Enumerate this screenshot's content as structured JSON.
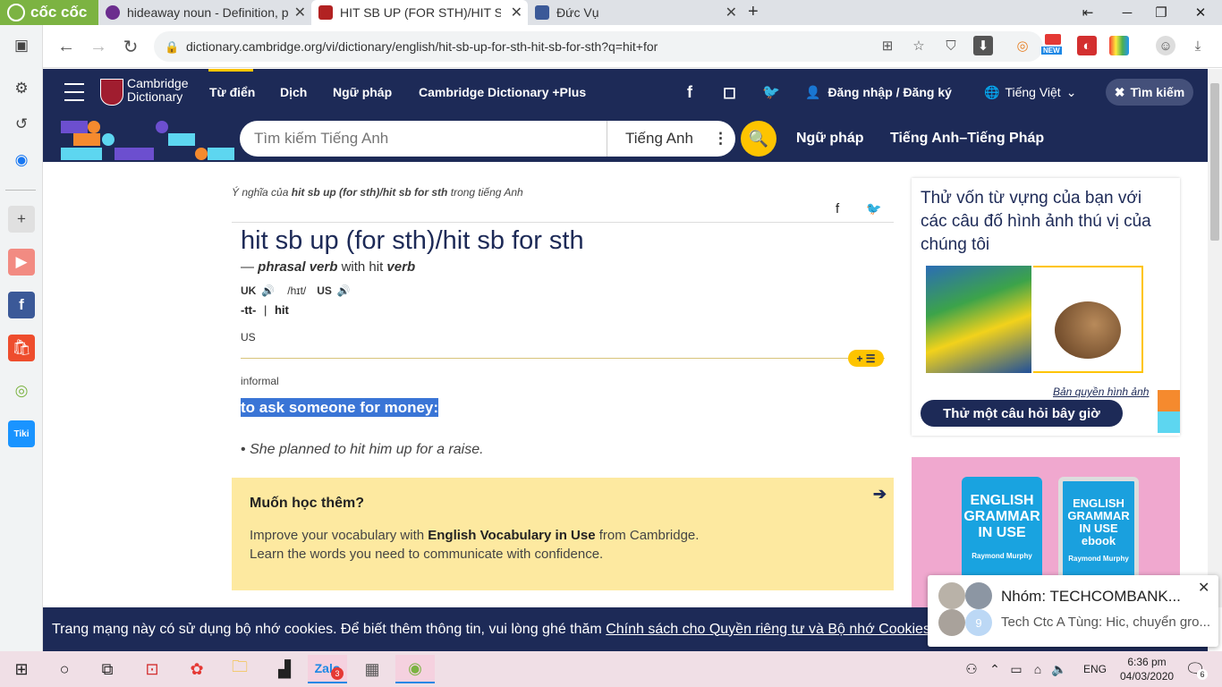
{
  "browser": {
    "logo_label": "cốc cốc",
    "tabs": [
      {
        "title": "hideaway noun - Definition, p",
        "favicon_color": "#6b2d8e"
      },
      {
        "title": "HIT SB UP (FOR STH)/HIT SB F",
        "favicon_color": "#b22222"
      },
      {
        "title": "Đức Vụ",
        "favicon_color": "#3b5998"
      }
    ],
    "new_tab": "+",
    "url": "dictionary.cambridge.org/vi/dictionary/english/hit-sb-up-for-sth-hit-sb-for-sth?q=hit+for",
    "ext_new_badge": "NEW"
  },
  "site": {
    "logo_line1": "Cambridge",
    "logo_line2": "Dictionary",
    "nav": [
      "Từ điển",
      "Dịch",
      "Ngữ pháp",
      "Cambridge Dictionary +Plus"
    ],
    "login": "Đăng nhập / Đăng ký",
    "language": "Tiếng Việt",
    "search_toggle": "Tìm kiếm",
    "search_placeholder": "Tìm kiếm Tiếng Anh",
    "search_lang": "Tiếng Anh",
    "strip_links": [
      "Ngữ pháp",
      "Tiếng Anh–Tiếng Pháp"
    ]
  },
  "entry": {
    "meaning_prefix": "Ý nghĩa của",
    "meaning_term": "hit sb up (for sth)/hit sb for sth",
    "meaning_suffix": "trong tiếng Anh",
    "headword": "hit sb up (for sth)/hit sb for sth",
    "pos_dash": "—",
    "pos": "phrasal verb",
    "pos_with": "with hit",
    "pos_verb": "verb",
    "uk": "UK",
    "ipa": "/hɪt/",
    "us": "US",
    "inflection_1": "-tt-",
    "inflection_sep": "|",
    "inflection_2": "hit",
    "region": "US",
    "register": "informal",
    "definition": "to ask someone for money:",
    "example_bullet": "•",
    "example": "She planned to hit him up for a raise.",
    "learn_title": "Muốn học thêm?",
    "learn_line1_a": "Improve your vocabulary with",
    "learn_line1_b": "English Vocabulary in Use",
    "learn_line1_c": "from Cambridge.",
    "learn_line2": "Learn the words you need to communicate with confidence."
  },
  "sidebar": {
    "quiz_title": "Thử vốn từ vựng của bạn với các câu đố hình ảnh thú vị của chúng tôi",
    "image_credit": "Bản quyền hình ảnh",
    "quiz_button": "Thử một câu hỏi bây giờ",
    "ad_book1": "ENGLISH GRAMMAR IN USE",
    "ad_book1_author": "Raymond Murphy",
    "ad_book2": "ENGLISH GRAMMAR IN USE ebook",
    "ad_book2_author": "Raymond Murphy"
  },
  "cookie": {
    "text": "Trang mạng này có sử dụng bộ nhớ cookies. Để biết thêm thông tin, vui lòng ghé thăm",
    "link": "Chính sách cho Quyền riêng tư và Bộ nhớ Cookies"
  },
  "notification": {
    "title": "Nhóm: TECHCOMBANK...",
    "message": "Tech Ctc A Tùng: Hic, chuyển gro...",
    "avatar_count": "9"
  },
  "taskbar": {
    "zalo_badge": "3",
    "lang": "ENG",
    "time": "6:36 pm",
    "date": "04/03/2020",
    "notif_count": "6"
  }
}
